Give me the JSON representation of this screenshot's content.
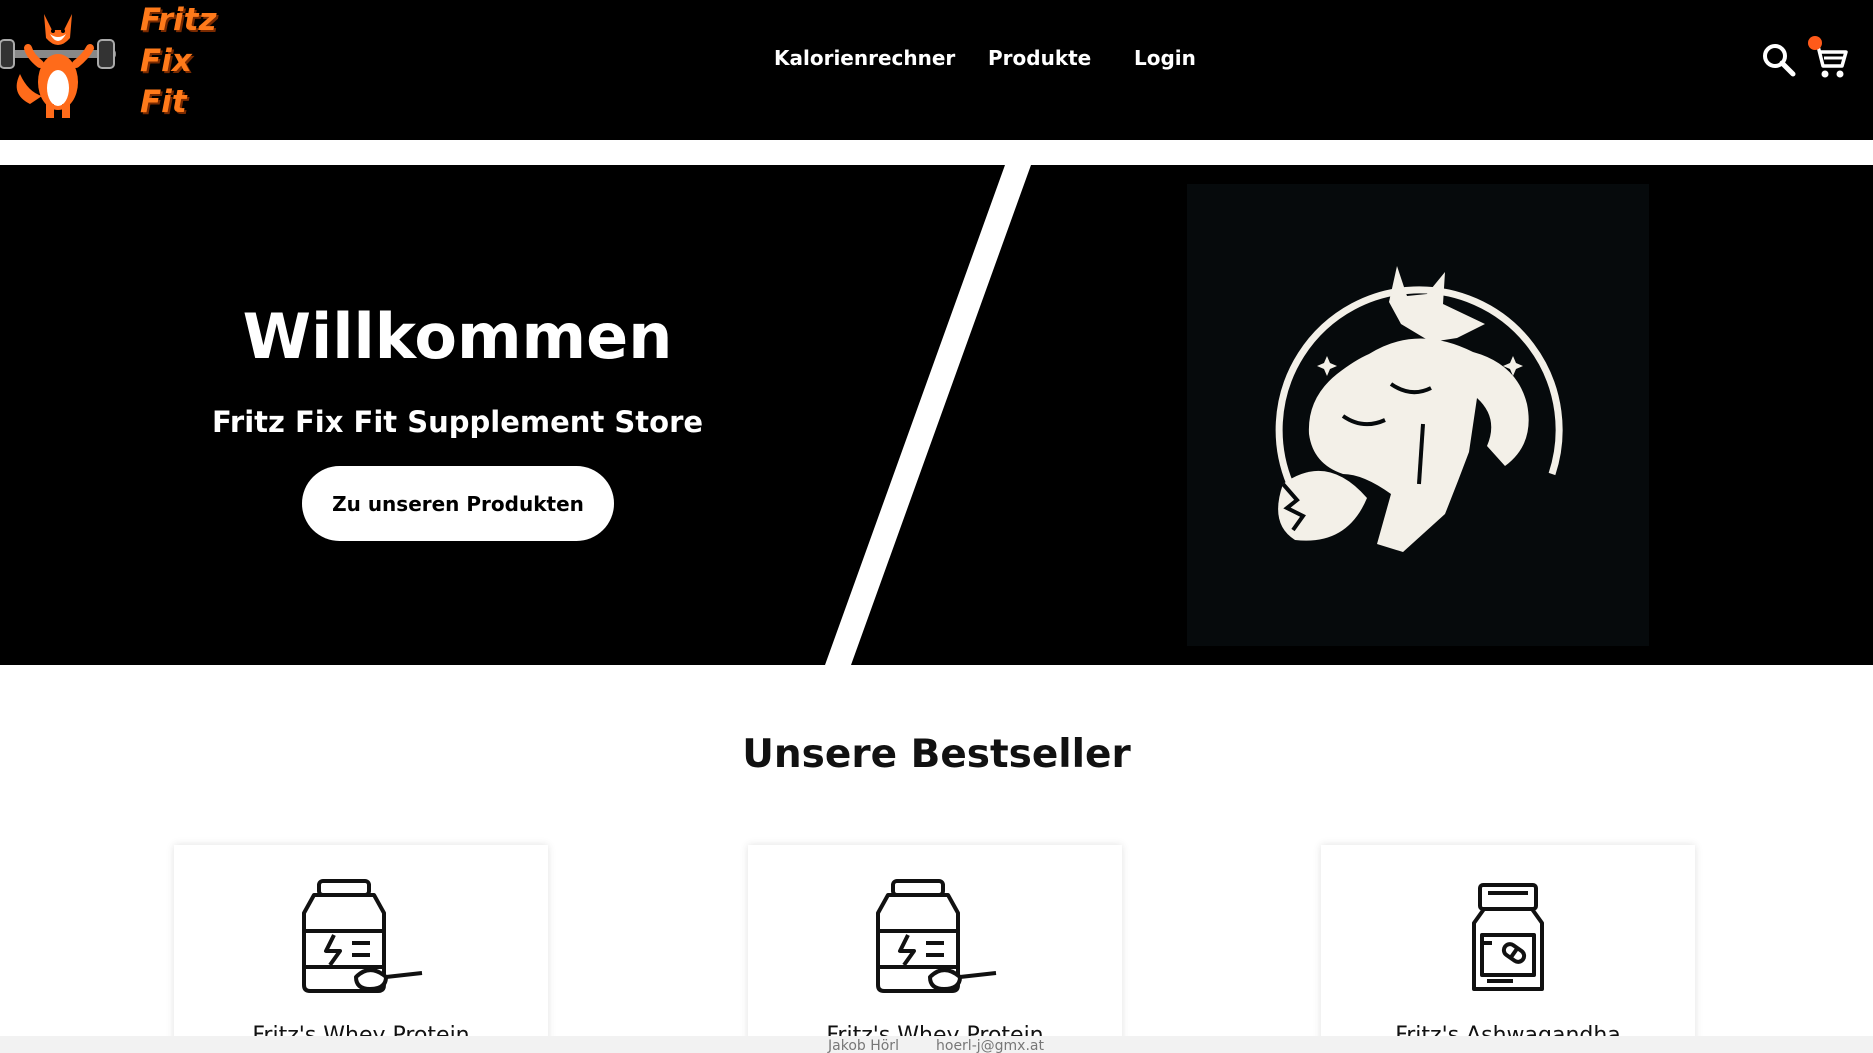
{
  "header": {
    "logo_text": [
      "Fritz",
      "Fix",
      "Fit"
    ],
    "nav": {
      "calculator": "Kalorienrechner",
      "products": "Produkte",
      "login": "Login"
    },
    "search_icon": "search-icon",
    "cart_icon": "cart-icon"
  },
  "hero": {
    "title": "Willkommen",
    "subtitle": "Fritz Fix Fit Supplement Store",
    "button_label": "Zu unseren Produkten",
    "image": "muscular-fox-logo"
  },
  "bestsellers": {
    "title": "Unsere Bestseller",
    "items": [
      {
        "name": "Fritz's Whey Protein",
        "icon": "protein-jar-icon"
      },
      {
        "name": "Fritz's Whey Protein",
        "icon": "protein-jar-icon"
      },
      {
        "name": "Fritz's Ashwagandha",
        "icon": "supplement-bottle-icon"
      }
    ]
  },
  "footer": {
    "name": "Jakob Hörl",
    "email": "hoerl-j@gmx.at"
  },
  "colors": {
    "header_bg": "#000000",
    "hero_bg": "#000000",
    "logo_orange": "#ff7a1a",
    "cart_badge": "#ff5a1a",
    "button_bg": "#ffffff"
  }
}
